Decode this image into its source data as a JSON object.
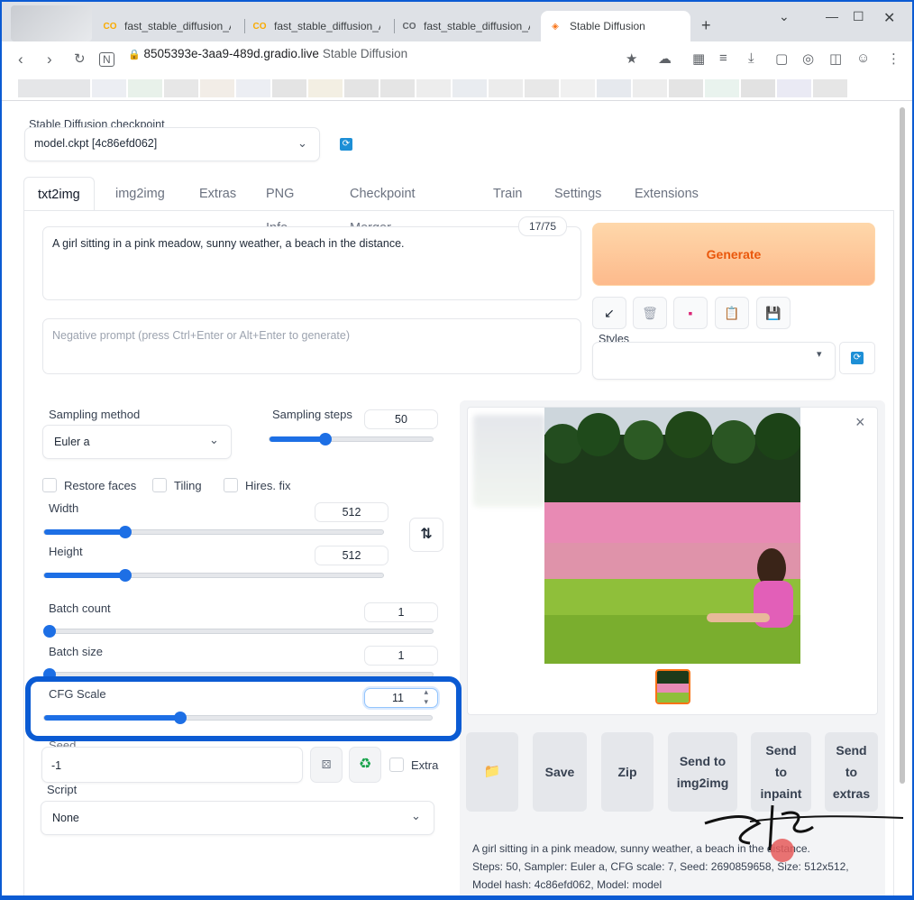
{
  "browser": {
    "tabs": [
      {
        "title": "fast_stable_diffusion_AU",
        "icon": "colab-icon"
      },
      {
        "title": "fast_stable_diffusion_AU",
        "icon": "colab-icon"
      },
      {
        "title": "fast_stable_diffusion_AU",
        "icon": "colab-icon"
      },
      {
        "title": "Stable Diffusion",
        "icon": "gradio-icon"
      }
    ],
    "new_tab": "+",
    "url": "8505393e-3aa9-489d.gradio.live",
    "page_title_hint": "Stable Diffusion"
  },
  "checkpoint": {
    "label": "Stable Diffusion checkpoint",
    "value": "model.ckpt [4c86efd062]"
  },
  "main_tabs": [
    "txt2img",
    "img2img",
    "Extras",
    "PNG Info",
    "Checkpoint Merger",
    "Train",
    "Settings",
    "Extensions"
  ],
  "prompt": {
    "value": "A girl sitting in a pink meadow, sunny weather, a beach in the distance.",
    "token_count": "17/75"
  },
  "negative_prompt": {
    "placeholder": "Negative prompt (press Ctrl+Enter or Alt+Enter to generate)"
  },
  "generate_label": "Generate",
  "styles_label": "Styles",
  "tools": [
    {
      "icon": "arrow-icon",
      "glyph": "↙"
    },
    {
      "icon": "trash-icon",
      "glyph": "🗑"
    },
    {
      "icon": "image-icon",
      "glyph": "▪"
    },
    {
      "icon": "clipboard-icon",
      "glyph": "📋"
    },
    {
      "icon": "save-icon",
      "glyph": "💾"
    }
  ],
  "sampling": {
    "method_label": "Sampling method",
    "method_value": "Euler a",
    "steps_label": "Sampling steps",
    "steps_value": "50",
    "steps_fraction": 0.34
  },
  "checkboxes": {
    "restore_faces": "Restore faces",
    "tiling": "Tiling",
    "hires_fix": "Hires. fix"
  },
  "width": {
    "label": "Width",
    "value": "512",
    "fraction": 0.24
  },
  "height": {
    "label": "Height",
    "value": "512",
    "fraction": 0.24
  },
  "swap_icon": "⇅",
  "batch_count": {
    "label": "Batch count",
    "value": "1",
    "fraction": 0.0
  },
  "batch_size": {
    "label": "Batch size",
    "value": "1",
    "fraction": 0.0
  },
  "cfg": {
    "label": "CFG Scale",
    "value": "11",
    "fraction": 0.35
  },
  "seed": {
    "label": "Seed",
    "value": "-1",
    "extra_label": "Extra"
  },
  "script": {
    "label": "Script",
    "value": "None"
  },
  "output_buttons": {
    "folder": "📁",
    "save": "Save",
    "zip": "Zip",
    "send_img2img": "Send to img2img",
    "send_inpaint": "Send to inpaint",
    "send_extras": "Send to extras"
  },
  "close_glyph": "×",
  "info": {
    "line1": "A girl sitting in a pink meadow, sunny weather, a beach in the distance.",
    "line2": "Steps: 50, Sampler: Euler a, CFG scale: 7, Seed: 2690859658, Size: 512x512,",
    "line3": "Model hash: 4c86efd062, Model: model"
  },
  "colors": {
    "accent": "#1d6fe5",
    "generate_bg": "#fdba8c",
    "generate_text": "#ea580c",
    "highlight": "#0b5bd3"
  }
}
